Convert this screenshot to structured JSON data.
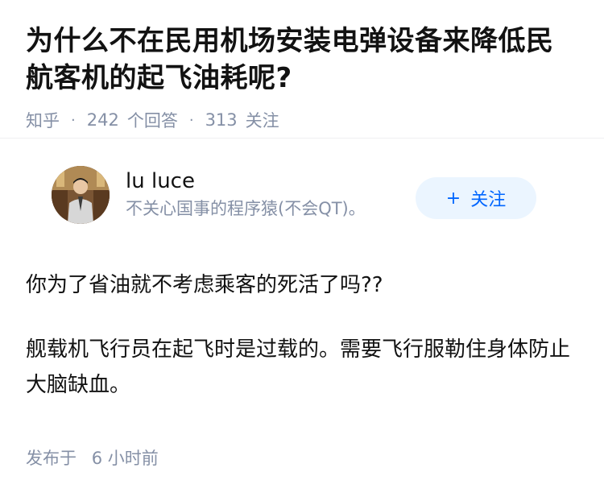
{
  "question": {
    "title": "为什么不在民用机场安装电弹设备来降低民航客机的起飞油耗呢?",
    "source": "知乎",
    "answer_count": "242",
    "answer_label": "个回答",
    "follower_count": "313",
    "follower_label": "关注"
  },
  "answer": {
    "author": {
      "name": "lu luce",
      "bio": "不关心国事的程序猿(不会QT)。",
      "avatar_icon": "user-avatar-photo"
    },
    "follow_button": {
      "icon": "plus-icon",
      "label": "关注"
    },
    "paragraphs": [
      "你为了省油就不考虑乘客的死活了吗??",
      "舰载机飞行员在起飞时是过载的。需要飞行服勒住身体防止大脑缺血。"
    ],
    "published_prefix": "发布于",
    "published_time": "6 小时前"
  },
  "colors": {
    "accent": "#0066ff",
    "accent_bg": "#ebf5ff",
    "muted": "#8590a6",
    "text": "#121212"
  }
}
